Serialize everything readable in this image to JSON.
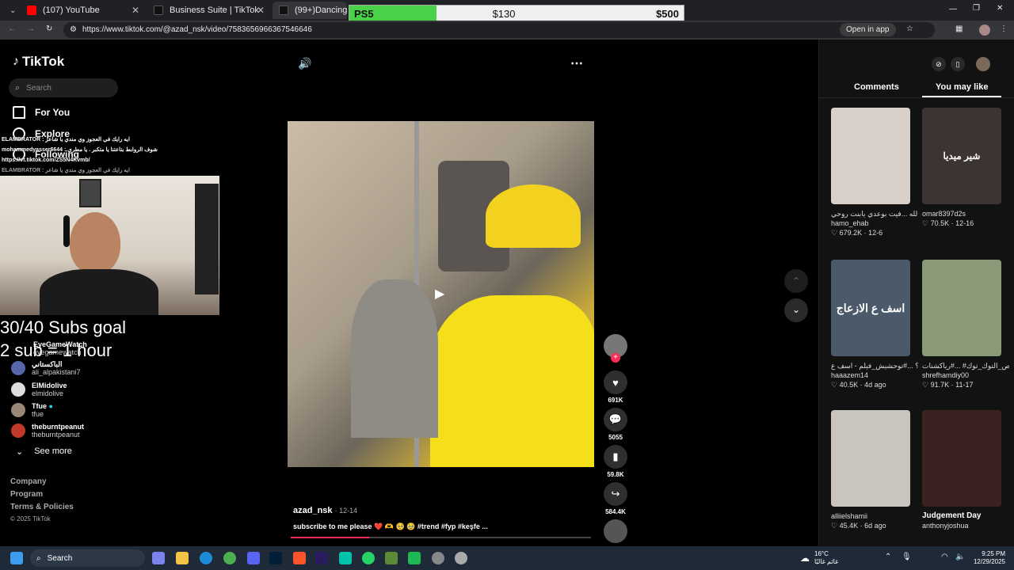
{
  "browser": {
    "tabs": [
      {
        "label": "(107) YouTube",
        "color": "#ff0000"
      },
      {
        "label": "Business Suite | TikTok",
        "color": "#111111"
      },
      {
        "label": "(99+)Dancing Dog Tr",
        "color": "#111111"
      }
    ],
    "url": "https://www.tiktok.com/@azad_nsk/video/7583656966367546646",
    "open_in_app": "Open in app"
  },
  "goal_overlay": {
    "item": "PS5",
    "current": "$130",
    "target": "$500",
    "progress_fraction": 0.26
  },
  "sidebar": {
    "logo": "TikTok",
    "search_placeholder": "Search",
    "nav": [
      {
        "label": "For You",
        "icon": "home-icon"
      },
      {
        "label": "Explore",
        "icon": "compass-icon"
      },
      {
        "label": "Following",
        "icon": "users-icon"
      }
    ],
    "accounts": [
      {
        "name": "EyeGameWatch",
        "handle": "eyegamewatch"
      },
      {
        "name": "الباكستاني",
        "handle": "ali_alpakistani7"
      },
      {
        "name": "ElMidolive",
        "handle": "elmidolive"
      },
      {
        "name": "Tfue",
        "handle": "tfue"
      },
      {
        "name": "theburntpeanut",
        "handle": "theburntpeanut"
      }
    ],
    "see_more": "See more",
    "footer": [
      "Company",
      "Program",
      "Terms & Policies",
      "© 2025 TikTok"
    ]
  },
  "stream_overlay": {
    "chat": [
      "ELAMBRATOR : ايه رايك في العجوز وي مندي يا شاعر",
      "mohammedyasser6644 : شوف الروابط بتاعتنا يا متكبر . يا مطري",
      "https://vt.tiktok.com/ZS5N4Kvmb/",
      "ELAMBRATOR : ايه رايك في العجوز وي مندي يا شاعر"
    ],
    "goal_line1": "30/40 Subs goal",
    "goal_line2": "2 sub = 1 hour"
  },
  "video": {
    "author": "azad_nsk",
    "date": "12-14",
    "caption": "subscribe to me please ❤️ 🫶 🥺 🥹 #trend #fyp #keşfe ...",
    "likes": "691K",
    "comments": "5055",
    "saves": "59.8K",
    "shares": "584.4K"
  },
  "right_panel": {
    "tabs": [
      "Comments",
      "You may like"
    ],
    "cards": [
      {
        "caption": "وعد الحر دين والحمد لله ...فيت بوعدي يابنت روحي",
        "user": "hamo_ehab",
        "stats": "679.2K · 12-6",
        "bg": "#d9d0c9"
      },
      {
        "caption": "",
        "user": "omar8397d2s",
        "stats": "70.5K · 12-16",
        "bg": "#3b3430",
        "overlay": "شير ميديا"
      },
      {
        "caption": "ليه عملتي فيا كدا؟ ...#توحشيش_فيلم - اسف ع",
        "user": "haaazem14",
        "stats": "40.5K · 4d ago",
        "bg": "#4a5a6a",
        "overlay": "اسف ع الازعاج"
      },
      {
        "caption": "قصص_التوك_توك# ...#رياكشنات #comedi",
        "user": "shrefhamdiy00",
        "stats": "91.7K · 11-17",
        "bg": "#8a9a78"
      },
      {
        "caption": "",
        "user": "alliielshamii",
        "stats": "45.4K · 6d ago",
        "bg": "#c9c4bd"
      },
      {
        "caption": "Judgement Day",
        "user": "anthonyjoshua",
        "stats": "",
        "bg": "#3a2220"
      }
    ]
  },
  "taskbar": {
    "search": "Search",
    "weather_temp": "16°C",
    "weather_desc": "غائم غالبًا",
    "time": "9:25 PM",
    "date": "12/29/2025"
  }
}
